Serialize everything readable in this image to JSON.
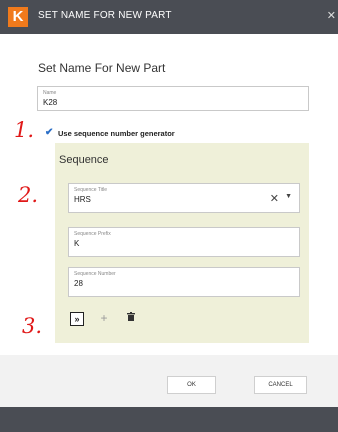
{
  "window": {
    "logo_letter": "K",
    "title": "SET NAME FOR NEW PART",
    "close_glyph": "✕"
  },
  "dialog": {
    "heading": "Set Name For New Part",
    "name_field": {
      "label": "Name",
      "value": "K28"
    },
    "use_sequence": {
      "checked": true,
      "label": "Use sequence number generator"
    }
  },
  "sequence": {
    "title": "Sequence",
    "title_field": {
      "label": "Sequence Title",
      "value": "HRS"
    },
    "prefix_field": {
      "label": "Sequence Prefix",
      "value": "K"
    },
    "number_field": {
      "label": "Sequence Number",
      "value": "28"
    },
    "tools": [
      "next-icon",
      "plus-icon",
      "trash-icon"
    ]
  },
  "footer": {
    "ok_label": "OK",
    "cancel_label": "CANCEL"
  },
  "annotations": {
    "one": "1.",
    "two": "2.",
    "three": "3."
  },
  "colors": {
    "titlebar": "#4a4d54",
    "logo": "#f07a1c",
    "panel": "#eff0d9",
    "annotation": "#e01818",
    "checkbox": "#2a6ec7"
  }
}
